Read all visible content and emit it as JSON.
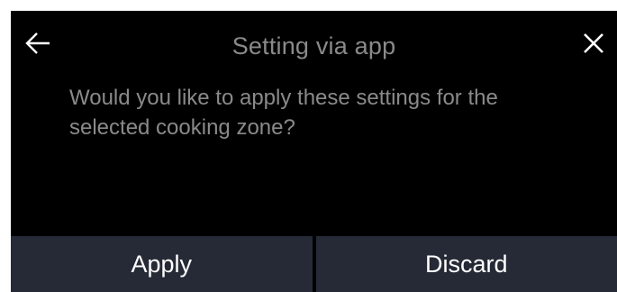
{
  "dialog": {
    "title": "Setting via app",
    "message": "Would you like to apply these settings for the selected cooking zone?",
    "back_icon": "arrow-left-icon",
    "close_icon": "close-icon"
  },
  "buttons": {
    "apply_label": "Apply",
    "discard_label": "Discard"
  },
  "colors": {
    "background": "#000000",
    "text_muted": "#8a8a8a",
    "button_bg": "#252a36",
    "button_text": "#ffffff",
    "icon": "#ffffff"
  }
}
